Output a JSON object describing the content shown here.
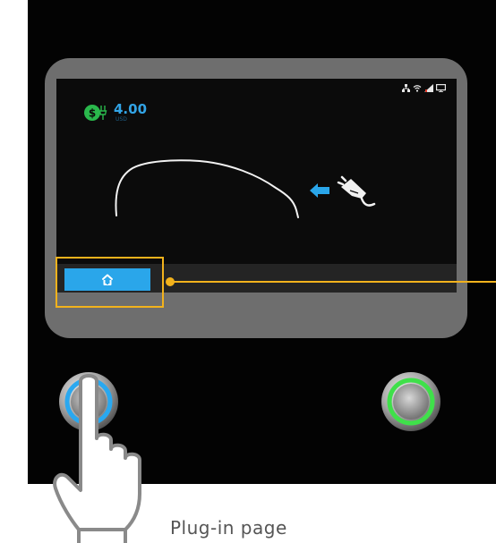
{
  "screen": {
    "price": {
      "value": "4.00",
      "currency": "USD"
    },
    "status_icons": [
      "network-icon",
      "wifi-icon",
      "cellular-signal-icon",
      "display-icon"
    ]
  },
  "home_button": {
    "icon": "home-icon"
  },
  "hardware_buttons": [
    {
      "name": "left-hardware-button",
      "ring_color": "#29a8f0"
    },
    {
      "name": "right-hardware-button",
      "ring_color": "#3fe04a"
    }
  ],
  "caption": "Plug-in page",
  "colors": {
    "accent_blue": "#2aa6ea",
    "price_green": "#2ab84c",
    "highlight_yellow": "#f2b21c"
  }
}
